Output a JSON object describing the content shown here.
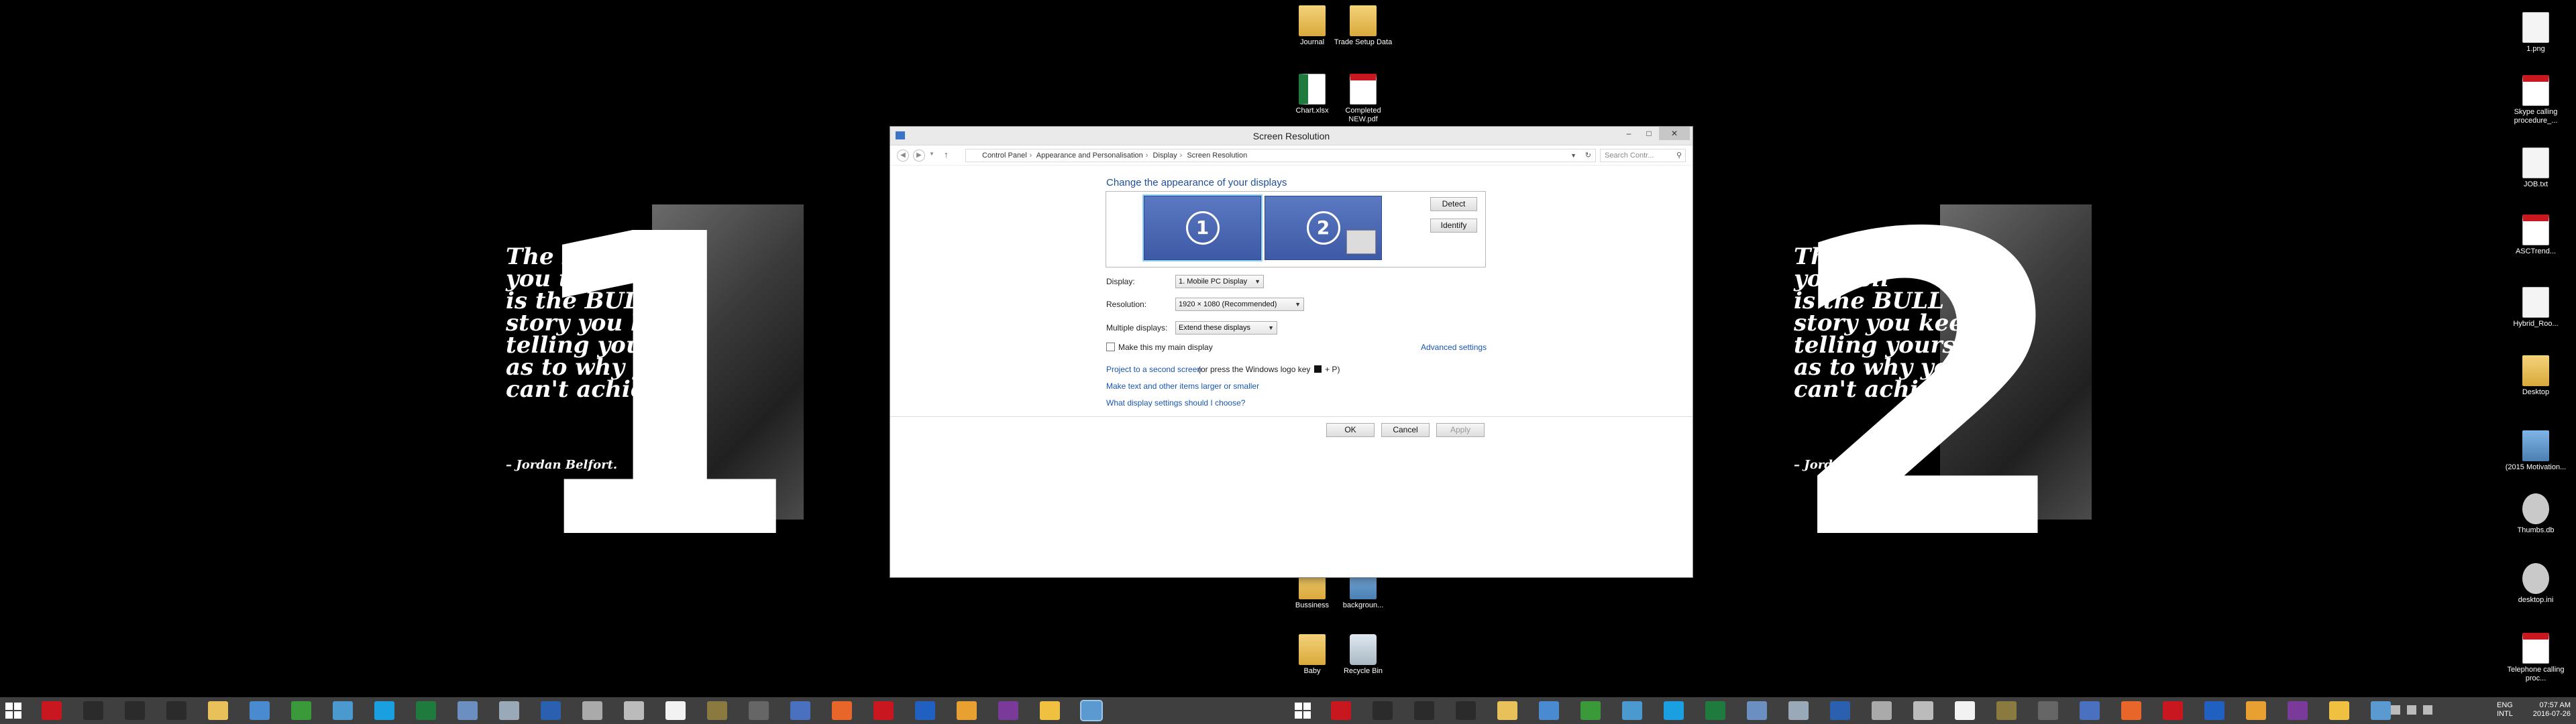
{
  "wallpaper": {
    "monitor1_number": "1",
    "monitor2_number": "2",
    "quote_lines": [
      "The stories",
      "you tell",
      "is the BULL",
      "story you keep",
      "telling yourself",
      "as to why you",
      "can't achieve"
    ],
    "quote_author": "– Jordan Belfort."
  },
  "desktop_icons": [
    {
      "name": "journal",
      "label": "Journal",
      "type": "folder"
    },
    {
      "name": "trade-setup-data",
      "label": "Trade Setup Data",
      "type": "folder"
    },
    {
      "name": "chart-xlsx",
      "label": "Chart.xlsx",
      "type": "xls"
    },
    {
      "name": "completed-pdf",
      "label": "Completed NEW.pdf",
      "type": "pdf"
    },
    {
      "name": "bussiness",
      "label": "Bussiness",
      "type": "folder"
    },
    {
      "name": "background",
      "label": "backgroun...",
      "type": "img"
    },
    {
      "name": "baby",
      "label": "Baby",
      "type": "folder"
    },
    {
      "name": "recycle-bin",
      "label": "Recycle Bin",
      "type": "bin"
    },
    {
      "name": "1-png",
      "label": "1.png",
      "type": "file"
    },
    {
      "name": "skype-calling",
      "label": "Skype calling procedure_...",
      "type": "pdf"
    },
    {
      "name": "job-txt",
      "label": "JOB.txt",
      "type": "file"
    },
    {
      "name": "asctrend",
      "label": "ASCTrend...",
      "type": "pdf"
    },
    {
      "name": "hybrid-roo",
      "label": "Hybrid_Roo...",
      "type": "file"
    },
    {
      "name": "desktop",
      "label": "Desktop",
      "type": "folder"
    },
    {
      "name": "motivation",
      "label": "(2015 Motivation...",
      "type": "img"
    },
    {
      "name": "thumbs-db",
      "label": "Thumbs.db",
      "type": "gear"
    },
    {
      "name": "desktop-ini",
      "label": "desktop.ini",
      "type": "gear"
    },
    {
      "name": "telephone-calling",
      "label": "Telephone calling proc...",
      "type": "pdf"
    }
  ],
  "window": {
    "title": "Screen Resolution",
    "controls": {
      "minimize": "–",
      "maximize": "□",
      "close": "✕"
    },
    "breadcrumb": [
      "Control Panel",
      "Appearance and Personalisation",
      "Display",
      "Screen Resolution"
    ],
    "search_placeholder": "Search Contr...",
    "heading": "Change the appearance of your displays",
    "monitor_labels": [
      "1",
      "2"
    ],
    "detect_label": "Detect",
    "identify_label": "Identify",
    "display_label": "Display:",
    "display_value": "1. Mobile PC Display",
    "resolution_label": "Resolution:",
    "resolution_value": "1920 × 1080 (Recommended)",
    "multiple_label": "Multiple displays:",
    "multiple_value": "Extend these displays",
    "main_display_label": "Make this my main display",
    "advanced_link": "Advanced settings",
    "project_link": "Project to a second screen",
    "project_suffix": " (or press the Windows logo key",
    "project_keys": " + P)",
    "text_size_link": "Make text and other items larger or smaller",
    "which_settings_link": "What display settings should I choose?",
    "ok_label": "OK",
    "cancel_label": "Cancel",
    "apply_label": "Apply"
  },
  "taskbar": {
    "lang1": "ENG",
    "lang2": "INTL",
    "time": "07:57 AM",
    "date": "2016-07-26",
    "icon_colors": [
      "#c8171e",
      "#2b2b2b",
      "#2b2b2b",
      "#2b2b2b",
      "#e8c15a",
      "#4a8ad0",
      "#3a9a3a",
      "#4a9ad0",
      "#1aa0e0",
      "#1f7a3e",
      "#6a8fc0",
      "#9aa9b8",
      "#2b5fb0",
      "#aaaaaa",
      "#bbbbbb",
      "#f2f2f2",
      "#8a7a40",
      "#666",
      "#4a70c0",
      "#e8662a",
      "#c8171e",
      "#2060c0",
      "#e8a030",
      "#7a3a9a",
      "#f0c040",
      "#5a9ad0"
    ]
  }
}
